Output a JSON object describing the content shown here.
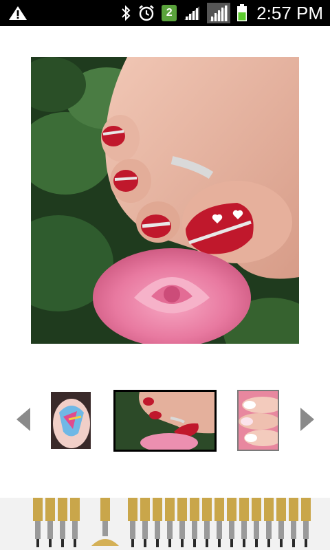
{
  "status_bar": {
    "time": "2:57 PM",
    "notification_count": "2",
    "icons": [
      "warning-icon",
      "bluetooth-icon",
      "alarm-icon",
      "notification-badge",
      "wifi-icon",
      "signal-icon",
      "battery-icon"
    ],
    "battery_color": "#5ccc2e"
  },
  "gallery": {
    "selected_index": 1,
    "thumbnails": [
      "thumbnail-1",
      "thumbnail-2",
      "thumbnail-3"
    ],
    "prev_icon": "triangle-left-icon",
    "next_icon": "triangle-right-icon",
    "arrow_color": "#8a8a8a"
  },
  "colors": {
    "nail_red": "#c0182c",
    "rose_pink": "#f28fb0",
    "leaf_green": "#2f5c2e",
    "skin": "#e9b8a6"
  }
}
